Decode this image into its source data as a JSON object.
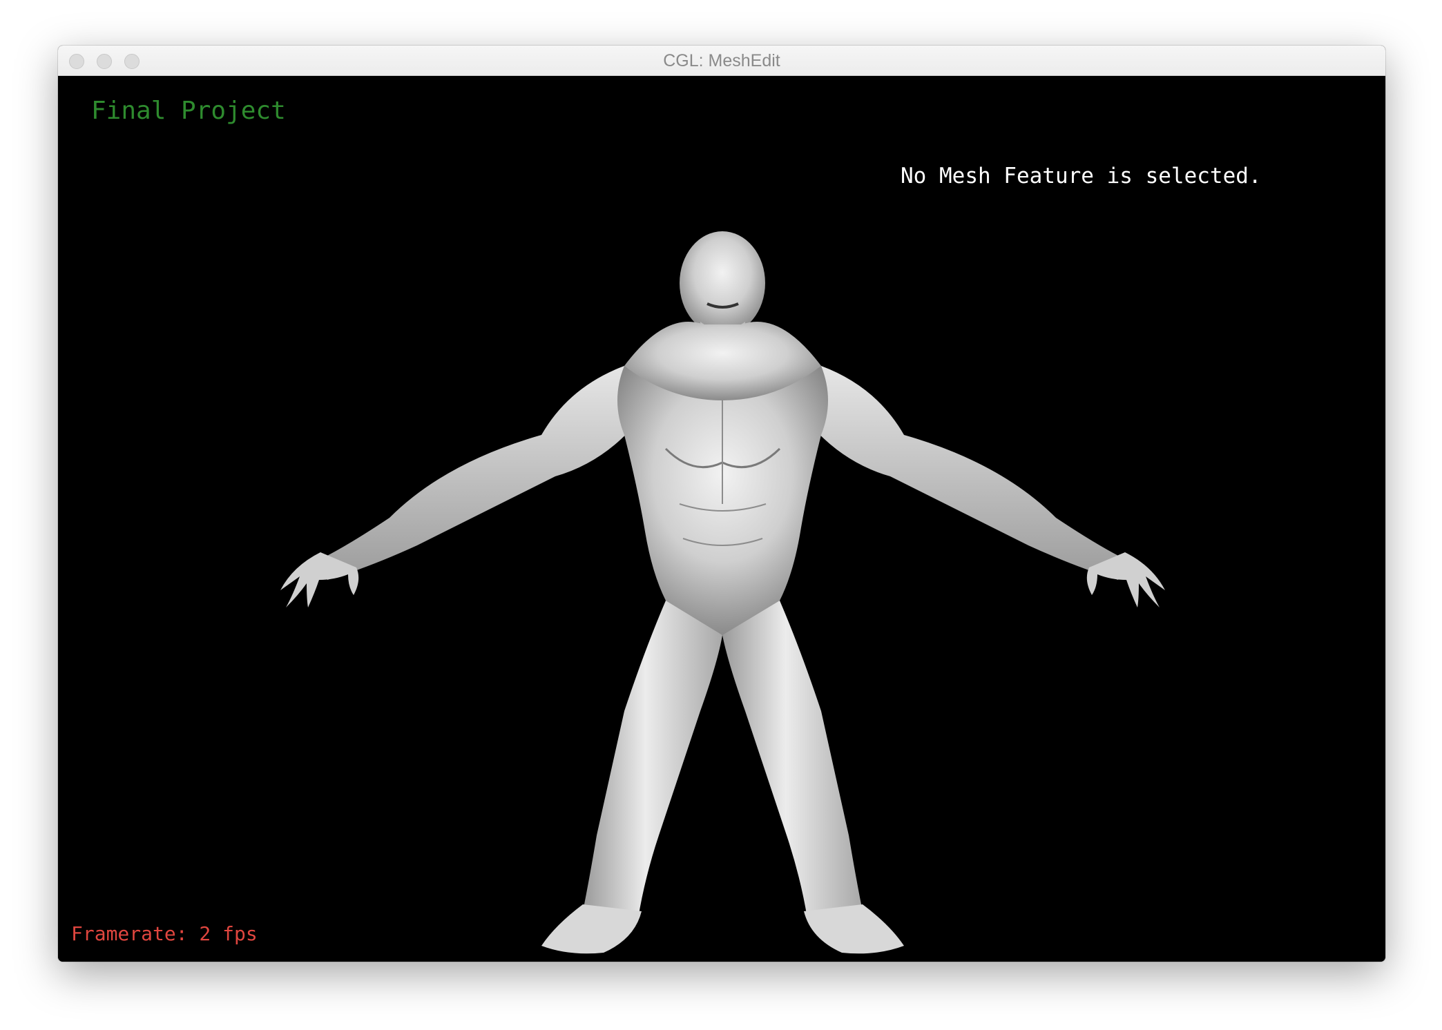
{
  "window": {
    "title": "CGL: MeshEdit"
  },
  "viewport": {
    "project_label": "Final Project",
    "selection_status": "No Mesh Feature is selected.",
    "framerate_label": "Framerate: 2 fps"
  },
  "colors": {
    "project_label": "#2e8b2e",
    "selection_status": "#ffffff",
    "framerate_label": "#e0463f",
    "background": "#000000",
    "mesh": "#d9d9d9"
  },
  "icons": {
    "close": "close-button-icon",
    "minimize": "minimize-button-icon",
    "zoom": "zoom-button-icon"
  }
}
